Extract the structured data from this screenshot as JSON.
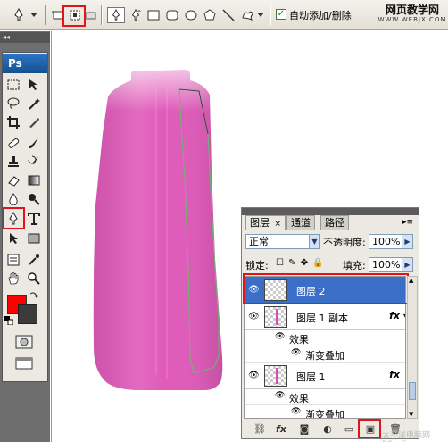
{
  "options_bar": {
    "auto_add_delete": {
      "checked": true,
      "check_mark": "✓",
      "label": "自动添加/删除"
    },
    "brand_cn": "网页教学网",
    "brand_url": "WWW.WEBJX.COM",
    "icons": [
      "pen-icon",
      "dropdown-arrow-icon",
      "shape-layers-icon",
      "paths-icon",
      "fill-pixels-icon",
      "pen-tool-icon",
      "freeform-pen-icon",
      "rectangle-icon",
      "rounded-rectangle-icon",
      "ellipse-icon",
      "polygon-icon",
      "line-icon",
      "custom-shape-icon"
    ]
  },
  "tools_panel": {
    "logo": "Ps",
    "foreground_color": "#ff0000",
    "background_color": "#3b3b3b"
  },
  "canvas": {
    "bottle_color_top": "#f5c3e6",
    "bottle_color": "#e05aba",
    "path_color": "#6db86d"
  },
  "layers_panel": {
    "tabs": [
      {
        "label": "图层",
        "close": "×",
        "active": true
      },
      {
        "label": "通道",
        "active": false
      },
      {
        "label": "路径",
        "active": false
      }
    ],
    "blend_mode": "正常",
    "opacity_label": "不透明度:",
    "opacity_value": "100%",
    "lock_label": "锁定:",
    "fill_label": "填充:",
    "fill_value": "100%",
    "layers": [
      {
        "name": "图层 2",
        "selected": true,
        "fx": ""
      },
      {
        "name": "图层 1 副本",
        "selected": false,
        "fx": "fx",
        "effects_label": "效果",
        "effect": "渐变叠加"
      },
      {
        "name": "图层 1",
        "selected": false,
        "fx": "fx",
        "effects_label": "效果",
        "effect": "渐变叠加"
      }
    ]
  },
  "watermark": "太平洋电脑网 PConline.com.cn",
  "accent_red": "#e1141c",
  "selection_blue": "#3b6fc7"
}
